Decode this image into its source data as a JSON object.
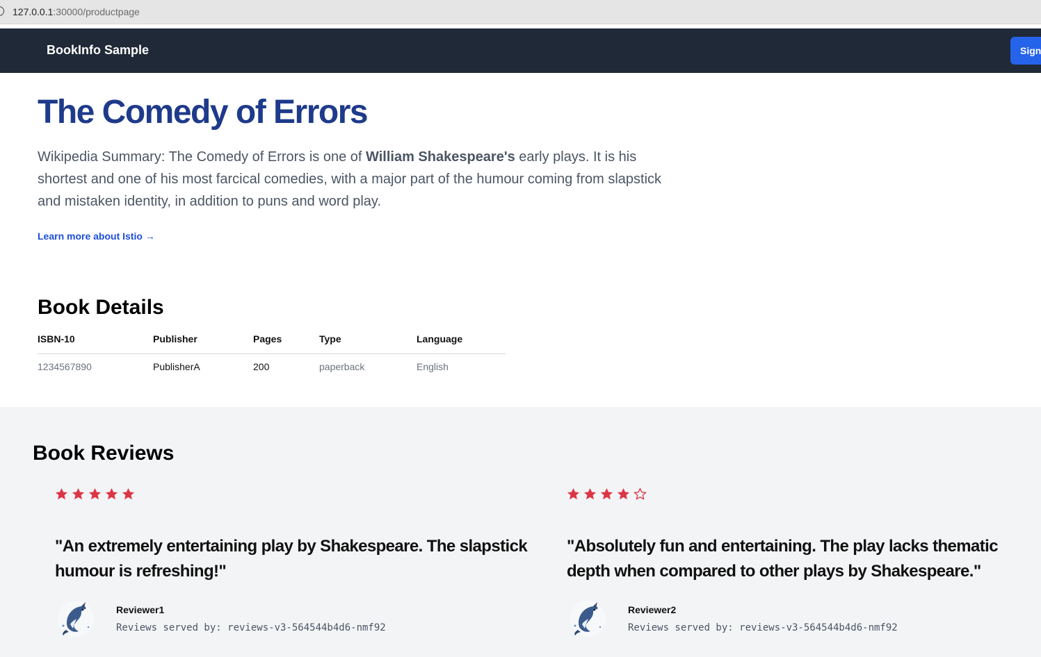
{
  "browser": {
    "url_host": "127.0.0.1",
    "url_rest": ":30000/productpage"
  },
  "navbar": {
    "brand": "BookInfo Sample",
    "signin_label": "Sign in"
  },
  "book": {
    "title": "The Comedy of Errors",
    "summary_prefix": "Wikipedia Summary: The Comedy of Errors is one of ",
    "summary_author": "William Shakespeare's",
    "summary_suffix": " early plays. It is his shortest and one of his most farcical comedies, with a major part of the humour coming from slapstick and mistaken identity, in addition to puns and word play.",
    "learn_more": "Learn more about Istio →"
  },
  "details": {
    "heading": "Book Details",
    "columns": [
      "ISBN-10",
      "Publisher",
      "Pages",
      "Type",
      "Language"
    ],
    "row": [
      "1234567890",
      "PublisherA",
      "200",
      "paperback",
      "English"
    ]
  },
  "reviews": {
    "heading": "Book Reviews",
    "star_color": "#dc3545",
    "items": [
      {
        "rating": 5,
        "max_rating": 5,
        "quote": "\"An extremely entertaining play by Shakespeare. The slapstick humour is refreshing!\"",
        "reviewer": "Reviewer1",
        "served_by": "Reviews served by: reviews-v3-564544b4d6-nmf92",
        "avatar_icon": "dolphin-avatar-icon"
      },
      {
        "rating": 4,
        "max_rating": 5,
        "quote": "\"Absolutely fun and entertaining. The play lacks thematic depth when compared to other plays by Shakespeare.\"",
        "reviewer": "Reviewer2",
        "served_by": "Reviews served by: reviews-v3-564544b4d6-nmf92",
        "avatar_icon": "dolphin-avatar-icon"
      }
    ]
  }
}
